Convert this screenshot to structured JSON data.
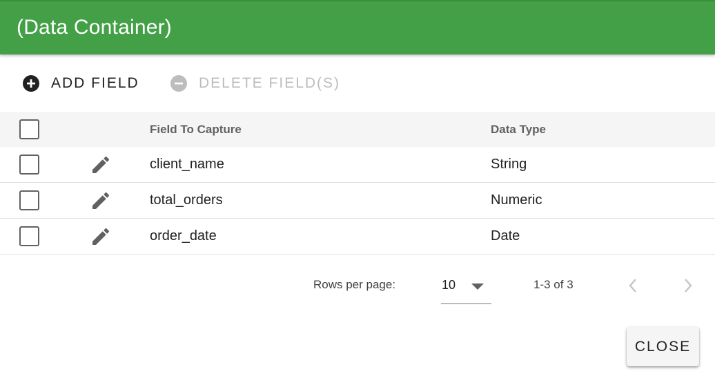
{
  "dialog": {
    "title": "(Data Container)"
  },
  "toolbar": {
    "add_label": "ADD FIELD",
    "delete_label": "DELETE FIELD(S)"
  },
  "table": {
    "columns": {
      "field": "Field To Capture",
      "type": "Data Type"
    },
    "rows": [
      {
        "field": "client_name",
        "type": "String"
      },
      {
        "field": "total_orders",
        "type": "Numeric"
      },
      {
        "field": "order_date",
        "type": "Date"
      }
    ]
  },
  "pagination": {
    "rows_per_page_label": "Rows per page:",
    "rows_per_page_value": "10",
    "range_label": "1-3 of 3"
  },
  "footer": {
    "close_label": "CLOSE"
  },
  "colors": {
    "header": "#43a047",
    "disabled": "#bdbdbd",
    "icon": "#616161"
  }
}
